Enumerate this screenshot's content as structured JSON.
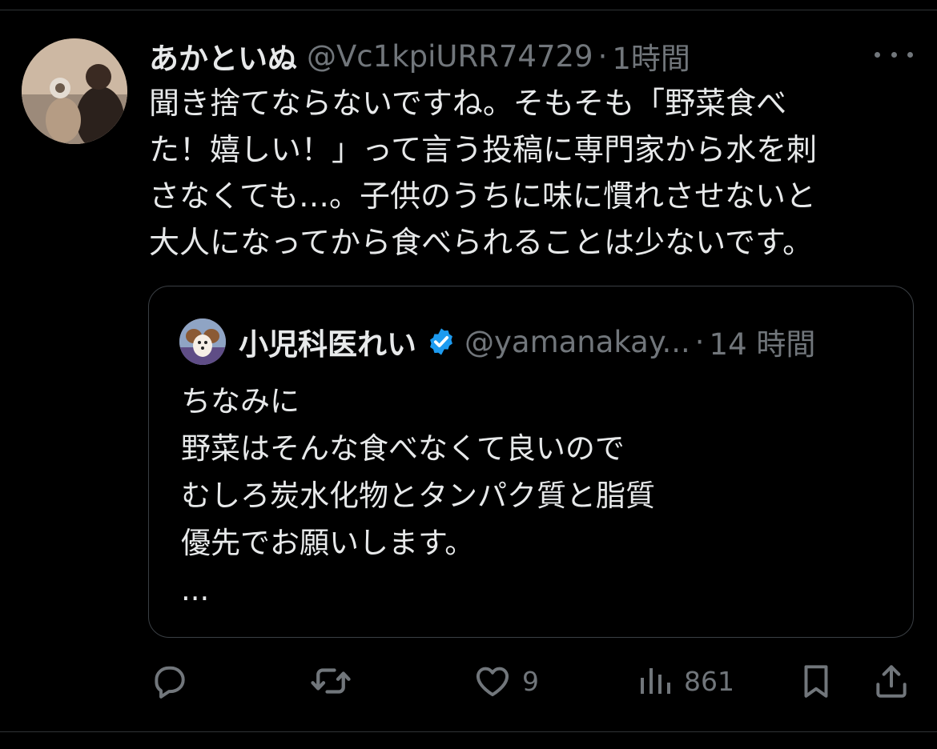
{
  "tweet": {
    "display_name": "あかといぬ",
    "handle": "@Vc1kpiURR74729",
    "separator": "·",
    "time": "1時間",
    "text": "聞き捨てならないですね。そもそも「野菜食べ\nた！嬉しい！」って言う投稿に専門家から水を刺\nさなくても…。子供のうちに味に慣れさせないと\n大人になってから食べられることは少ないです。",
    "more_icon": "more-horizontal-icon"
  },
  "quote": {
    "display_name": "小児科医れい",
    "verified_icon": "verified-badge-icon",
    "handle": "@yamanakay...",
    "separator": "·",
    "time": "14 時間",
    "text": "ちなみに\n野菜はそんな食べなくて良いので\nむしろ炭水化物とタンパク質と脂質\n優先でお願いします。\n..."
  },
  "actions": {
    "reply": {
      "icon": "reply-icon",
      "count": ""
    },
    "retweet": {
      "icon": "retweet-icon",
      "count": ""
    },
    "like": {
      "icon": "heart-icon",
      "count": "9"
    },
    "views": {
      "icon": "views-icon",
      "count": "861"
    },
    "bookmark": {
      "icon": "bookmark-icon"
    },
    "share": {
      "icon": "share-icon"
    }
  },
  "colors": {
    "background": "#000000",
    "text_primary": "#e7e9ea",
    "text_secondary": "#71767b",
    "border": "#2f3336",
    "verified": "#1d9bf0"
  }
}
